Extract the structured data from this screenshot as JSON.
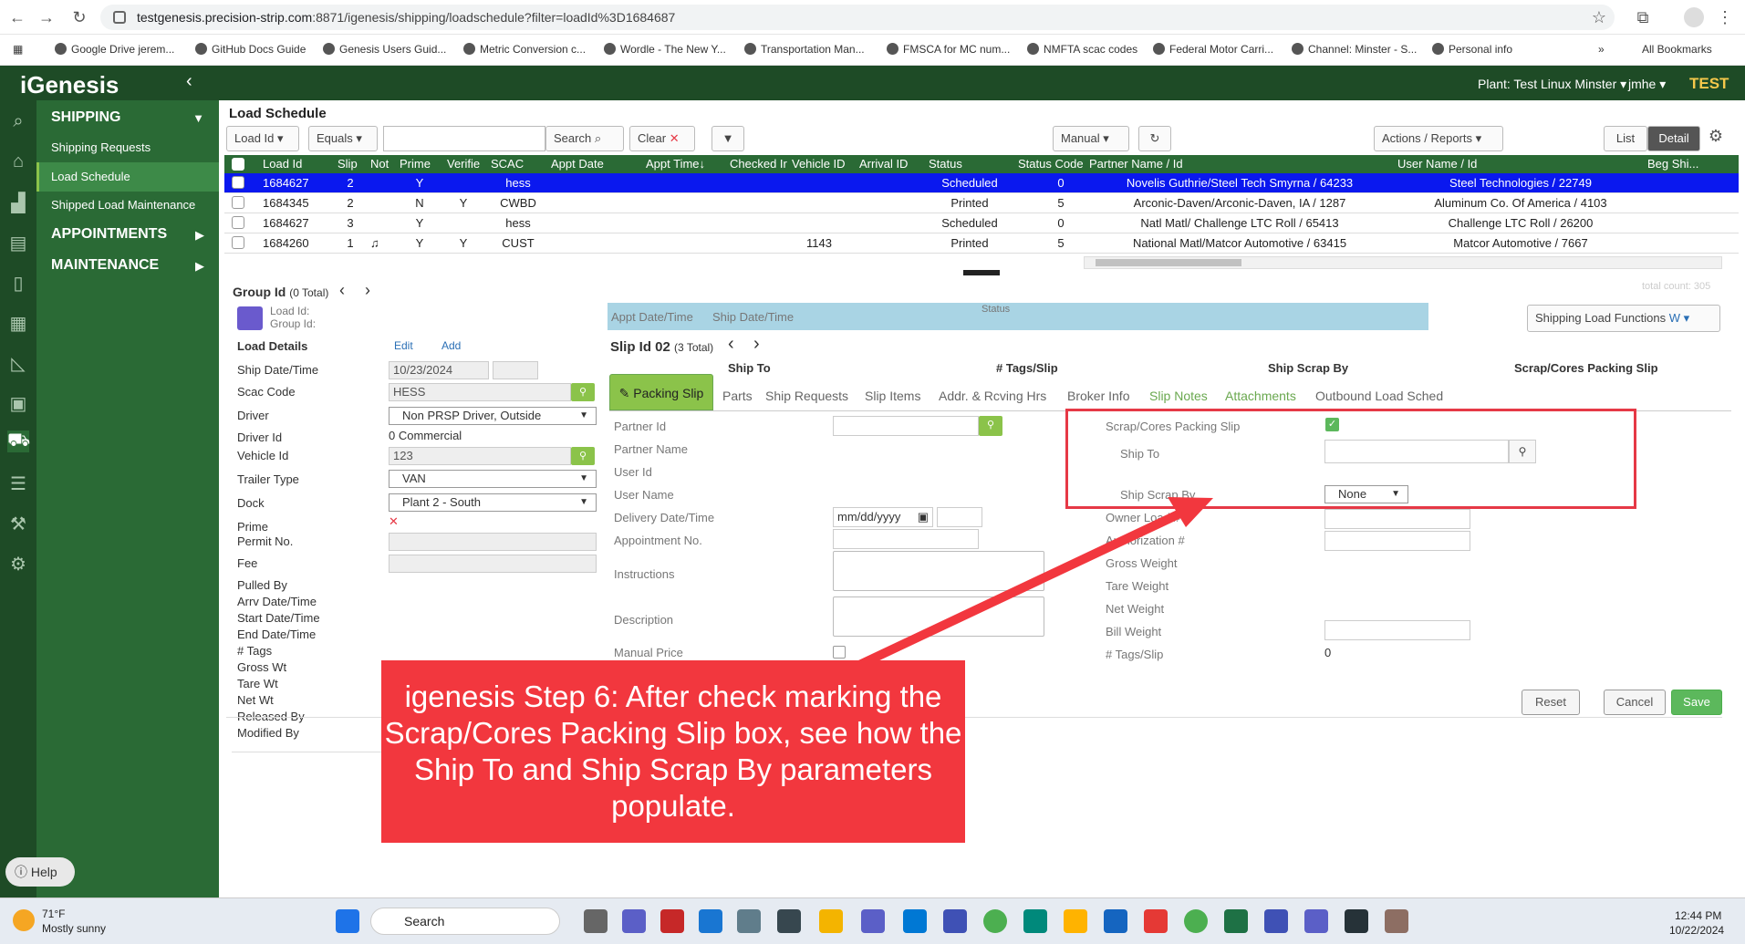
{
  "browser": {
    "url_host": "testgenesis.precision-strip.com",
    "url_rest": ":8871/igenesis/shipping/loadschedule?filter=loadId%3D1684687",
    "bookmarks": [
      "Google Drive jerem...",
      "GitHub Docs Guide",
      "Genesis Users Guid...",
      "Metric Conversion c...",
      "Wordle - The New Y...",
      "Transportation Man...",
      "FMSCA for MC num...",
      "NMFTA scac codes",
      "Federal Motor Carri...",
      "Channel: Minster - S...",
      "Personal info"
    ],
    "all_bookmarks": "All Bookmarks"
  },
  "app": {
    "logo": "iGenesis",
    "plant": "Plant: Test Linux Minster ▾",
    "user": "jmhe ▾",
    "env": "TEST"
  },
  "sidebar": {
    "shipping": "SHIPPING",
    "items": [
      "Shipping Requests",
      "Load Schedule",
      "Shipped Load Maintenance"
    ],
    "appointments": "APPOINTMENTS",
    "maintenance": "MAINTENANCE",
    "help": "Help"
  },
  "toolbar": {
    "title": "Load Schedule",
    "field": "Load Id",
    "op": "Equals",
    "search": "Search",
    "clear": "Clear",
    "mode": "Manual",
    "actions": "Actions / Reports",
    "list": "List",
    "detail": "Detail"
  },
  "grid": {
    "headers": [
      "Load Id",
      "Slip",
      "Not",
      "Prime",
      "Verifie",
      "SCAC",
      "Appt Date",
      "Appt Time↓",
      "Checked Ir",
      "Vehicle ID",
      "Arrival ID",
      "Status",
      "Status Code",
      "Partner Name / Id",
      "User Name / Id",
      "Beg Shi..."
    ],
    "rows": [
      {
        "load": "1684627",
        "slip": "2",
        "note": "",
        "prime": "Y",
        "ver": "",
        "scac": "hess",
        "veh": "",
        "status": "Scheduled",
        "code": "0",
        "partner": "Novelis Guthrie/Steel Tech Smyrna / 64233",
        "user": "Steel Technologies / 22749"
      },
      {
        "load": "1684345",
        "slip": "2",
        "note": "",
        "prime": "N",
        "ver": "Y",
        "scac": "CWBD",
        "veh": "",
        "status": "Printed",
        "code": "5",
        "partner": "Arconic-Daven/Arconic-Daven, IA / 1287",
        "user": "Aluminum Co. Of America / 4103"
      },
      {
        "load": "1684627",
        "slip": "3",
        "note": "",
        "prime": "Y",
        "ver": "",
        "scac": "hess",
        "veh": "",
        "status": "Scheduled",
        "code": "0",
        "partner": "Natl Matl/ Challenge LTC Roll / 65413",
        "user": "Challenge LTC Roll / 26200"
      },
      {
        "load": "1684260",
        "slip": "1",
        "note": "♫",
        "prime": "Y",
        "ver": "Y",
        "scac": "CUST",
        "veh": "1143",
        "status": "Printed",
        "code": "5",
        "partner": "National Matl/Matcor Automotive / 63415",
        "user": "Matcor Automotive / 7667"
      }
    ],
    "total": "total count: 305"
  },
  "group": {
    "title": "Group Id",
    "count": "(0 Total)",
    "load_id": "Load Id:",
    "group_id": "Group Id:"
  },
  "load_details": {
    "title": "Load Details",
    "edit": "Edit",
    "add": "Add",
    "labels": [
      "Ship Date/Time",
      "Scac Code",
      "Driver",
      "Driver Id",
      "Vehicle Id",
      "Trailer Type",
      "Dock",
      "Prime",
      "Permit No.",
      "Fee",
      "Pulled By",
      "Arrv Date/Time",
      "Start Date/Time",
      "End Date/Time",
      "# Tags",
      "Gross Wt",
      "Tare Wt",
      "Net Wt",
      "Released By",
      "Modified By"
    ],
    "ship_date": "10/23/2024",
    "scac": "HESS",
    "driver": "Non PRSP Driver, Outside",
    "driver_id": "0 Commercial",
    "vehicle_id": "123",
    "trailer": "VAN",
    "dock": "Plant 2 - South",
    "prime_x": "✕"
  },
  "slip": {
    "appt_hdr": "Appt Date/Time",
    "ship_hdr": "Ship Date/Time",
    "status_hdr": "Status",
    "functions": "Shipping Load Functions",
    "title": "Slip Id 02",
    "count": "(3 Total)",
    "cols": [
      "Ship To",
      "# Tags/Slip",
      "Ship Scrap By",
      "Scrap/Cores Packing Slip"
    ],
    "tabs": [
      "Packing Slip",
      "Parts",
      "Ship Requests",
      "Slip Items",
      "Addr. & Rcving Hrs",
      "Broker Info",
      "Slip Notes",
      "Attachments",
      "Outbound Load Sched"
    ]
  },
  "form": {
    "left": [
      "Partner Id",
      "Partner Name",
      "User Id",
      "User Name",
      "Delivery Date/Time",
      "Appointment No.",
      "Instructions",
      "Description",
      "Manual Price"
    ],
    "date_placeholder": "mm/dd/yyyy",
    "scrap_slip": "Scrap/Cores Packing Slip",
    "ship_to": "Ship To",
    "ship_scrap_by": "Ship Scrap By",
    "ship_scrap_val": "None",
    "right": [
      "Owner Load #",
      "Authorization #",
      "Gross Weight",
      "Tare Weight",
      "Net Weight",
      "Bill Weight",
      "# Tags/Slip"
    ],
    "tags_val": "0",
    "reset": "Reset",
    "cancel": "Cancel",
    "save": "Save"
  },
  "callout": "igenesis Step 6: After check marking the Scrap/Cores Packing Slip box, see how the Ship To and Ship Scrap By parameters populate.",
  "taskbar": {
    "temp": "71°F",
    "weather": "Mostly sunny",
    "search": "Search",
    "time": "12:44 PM",
    "date": "10/22/2024"
  },
  "colors": {
    "app_dark": "#1e4b26",
    "sidebar": "#2a6a35",
    "accent": "#8bc34a",
    "selected_row": "#0a18ef",
    "callout": "#f2373e"
  }
}
